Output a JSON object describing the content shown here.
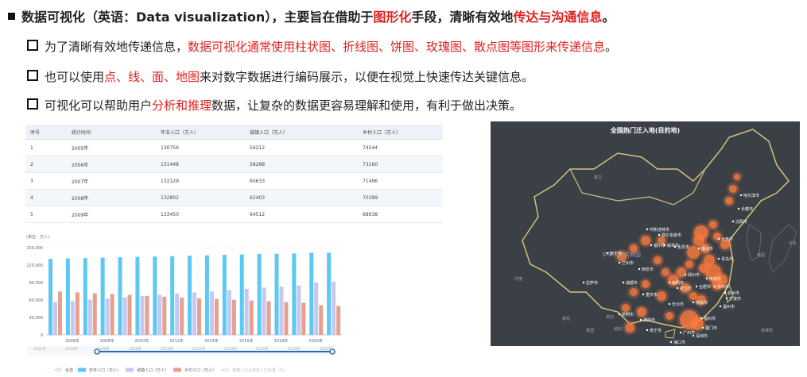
{
  "headline": {
    "a": "数据可视化（英语：Data visualization），主要旨在借助于",
    "b": "图形化",
    "c": "手段，清晰有效地",
    "d": "传达与沟通信息",
    "e": "。"
  },
  "bullets": [
    {
      "a": "为了清晰有效地传递信息，",
      "b": "数据可视化通常使用柱状图、折线图、饼图、玫瑰图、散点图等图形来传递信息",
      "c": "。"
    },
    {
      "a": "也可以使用",
      "b": "点、线、面、地图",
      "c": "来对数字数据进行编码展示，以便在视觉上快速传达关键信息。"
    },
    {
      "a": "可视化可以帮助用户",
      "b": "分析和推理",
      "c": "数据，让复杂的数据更容易理解和使用，有利于做出决策。"
    }
  ],
  "table": {
    "headers": [
      "序号",
      "统计时间",
      "年末人口（万人）",
      "城镇人口（万人）",
      "乡村人口（万人）"
    ],
    "rows": [
      [
        "1",
        "2005年",
        "130756",
        "56212",
        "74544"
      ],
      [
        "2",
        "2006年",
        "131448",
        "58288",
        "73160"
      ],
      [
        "3",
        "2007年",
        "132129",
        "60633",
        "71496"
      ],
      [
        "4",
        "2008年",
        "132802",
        "62403",
        "70399"
      ],
      [
        "5",
        "2009年",
        "133450",
        "64512",
        "68938"
      ]
    ]
  },
  "chart_data": {
    "type": "bar",
    "unit_label": "(单位：万人)",
    "categories": [
      "2005",
      "2006",
      "2007",
      "2008",
      "2009",
      "2010",
      "2011",
      "2012",
      "2013",
      "2014",
      "2015",
      "2016",
      "2017",
      "2018",
      "2019",
      "2020",
      "2021"
    ],
    "x_tick_labels": [
      "2006年",
      "2008年",
      "2010年",
      "2012年",
      "2014年",
      "2016年",
      "2018年",
      "2020年"
    ],
    "slider_labels": [
      "2002年",
      "2004年",
      "2006年",
      "2008年",
      "2010年",
      "2012年",
      "2014年",
      "2016年",
      "2018年",
      "2020年"
    ],
    "ylim": [
      0,
      150000
    ],
    "y_ticks": [
      "0",
      "30,000",
      "60,000",
      "90,000",
      "120,000",
      "150,000"
    ],
    "series": [
      {
        "name": "年末人口（万人）",
        "color": "#5bc8f5",
        "values": [
          130756,
          131448,
          132129,
          132802,
          133450,
          134091,
          134735,
          135404,
          136072,
          136782,
          137462,
          138271,
          139008,
          139538,
          140005,
          141212,
          141260
        ]
      },
      {
        "name": "城镇人口（万人）",
        "color": "#c5c8f0",
        "values": [
          56212,
          58288,
          60633,
          62403,
          64512,
          66978,
          69079,
          71182,
          73111,
          74916,
          77116,
          79298,
          81347,
          83137,
          84843,
          90220,
          91425
        ]
      },
      {
        "name": "乡村人口（万人）",
        "color": "#e8a08e",
        "values": [
          74544,
          73160,
          71496,
          70399,
          68938,
          67113,
          65656,
          64222,
          62961,
          61866,
          60346,
          58973,
          57661,
          56401,
          55162,
          50992,
          49835
        ]
      }
    ],
    "legend": [
      "全选",
      "年末人口（万人）",
      "城镇人口（万人）",
      "乡村人口（万人）",
      "城镇人口占年末人口比重（%）"
    ]
  },
  "map": {
    "title": "全国热门迁入地(目的地)",
    "bg_color": "#3b4046",
    "border_color": "#d4c27a",
    "regions": [
      "蒙古",
      "中华人民共和国",
      "韩国",
      "日本",
      "缅甸",
      "泰国",
      "越南",
      "老挝",
      "菲律宾",
      "印度"
    ],
    "cities": [
      "哈尔滨市",
      "长春市",
      "沈阳市",
      "呼和浩特市",
      "鄂尔多斯市",
      "银川市",
      "榆林市",
      "太原市",
      "大连市",
      "烟台市",
      "青岛市",
      "西宁市",
      "兰州市",
      "西安市",
      "郑州市",
      "南阳市",
      "合肥市",
      "南京市",
      "苏州市",
      "成都市",
      "重庆市",
      "武汉市",
      "长沙市",
      "南昌市",
      "杭州市",
      "宁波市",
      "温州市",
      "福州市",
      "厦门市",
      "昆明市",
      "贵阳市",
      "南宁市",
      "广州市",
      "深圳市",
      "海口市",
      "拉萨市"
    ]
  }
}
